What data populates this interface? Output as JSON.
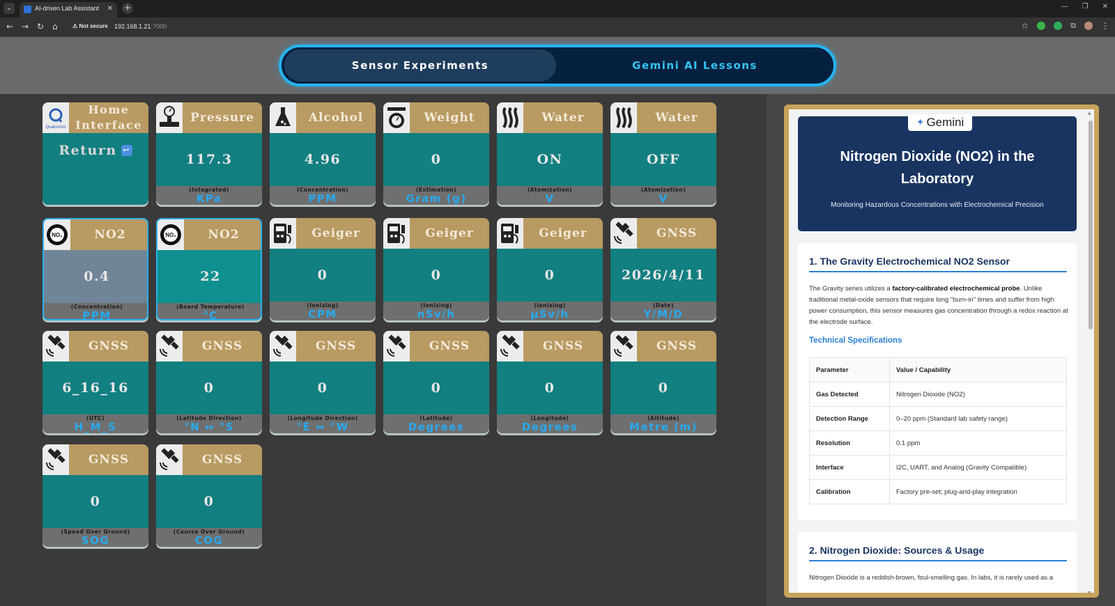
{
  "browser": {
    "tab_title": "AI-driven Lab Assistant",
    "tab_close": "✕",
    "new_tab": "+",
    "security": "Not secure",
    "url_host": "192.168.1.21",
    "url_port": ":7000"
  },
  "switch": {
    "left_label": "Sensor Experiments",
    "right_label": "Gemini AI Lessons"
  },
  "cards": [
    {
      "title": "Home Interface",
      "value": "Return",
      "sub": "",
      "unit": "",
      "icon": "qualcomm-logo-icon"
    },
    {
      "title": "Pressure",
      "value": "117.3",
      "sub": "(Integrated)",
      "unit": "KPa",
      "icon": "pressure-gauge-icon"
    },
    {
      "title": "Alcohol",
      "value": "4.96",
      "sub": "(Concentration)",
      "unit": "PPM",
      "icon": "flask-icon"
    },
    {
      "title": "Weight",
      "value": "0",
      "sub": "(Estimation)",
      "unit": "Gram (g)",
      "icon": "scale-icon"
    },
    {
      "title": "Water",
      "value": "ON",
      "sub": "(Atomization)",
      "unit": "V",
      "icon": "mist-icon"
    },
    {
      "title": "Water",
      "value": "OFF",
      "sub": "(Atomization)",
      "unit": "V",
      "icon": "mist-icon"
    },
    {
      "title": "NO2",
      "value": "0.4",
      "sub": "(Concentration)",
      "unit": "PPM",
      "icon": "no2-gear-icon"
    },
    {
      "title": "NO2",
      "value": "22",
      "sub": "(Board Temperature)",
      "unit": "°C",
      "icon": "no2-gear-icon"
    },
    {
      "title": "Geiger",
      "value": "0",
      "sub": "(Ionizing)",
      "unit": "CPM",
      "icon": "geiger-counter-icon"
    },
    {
      "title": "Geiger",
      "value": "0",
      "sub": "(Ionizing)",
      "unit": "nSv/h",
      "icon": "geiger-counter-icon"
    },
    {
      "title": "Geiger",
      "value": "0",
      "sub": "(Ionizing)",
      "unit": "μSv/h",
      "icon": "geiger-counter-icon"
    },
    {
      "title": "GNSS",
      "value": "2026/4/11",
      "sub": "(Date)",
      "unit": "Y/M/D",
      "icon": "satellite-icon"
    },
    {
      "title": "GNSS",
      "value": "6_16_16",
      "sub": "(UTC)",
      "unit": "H_M_S",
      "icon": "satellite-icon"
    },
    {
      "title": "GNSS",
      "value": "0",
      "sub": "(Latitude Direction)",
      "unit": "°N ↔ °S",
      "icon": "satellite-icon"
    },
    {
      "title": "GNSS",
      "value": "0",
      "sub": "(Longitude Direction)",
      "unit": "°E ↔ °W",
      "icon": "satellite-icon"
    },
    {
      "title": "GNSS",
      "value": "0",
      "sub": "(Latitude)",
      "unit": "Degrees",
      "icon": "satellite-icon"
    },
    {
      "title": "GNSS",
      "value": "0",
      "sub": "(Longitude)",
      "unit": "Degrees",
      "icon": "satellite-icon"
    },
    {
      "title": "GNSS",
      "value": "0",
      "sub": "(Altitude)",
      "unit": "Metre (m)",
      "icon": "satellite-icon"
    },
    {
      "title": "GNSS",
      "value": "0",
      "sub": "(Speed Over Ground)",
      "unit": "SOG",
      "icon": "satellite-icon"
    },
    {
      "title": "GNSS",
      "value": "0",
      "sub": "(Course Over Ground)",
      "unit": "COG",
      "icon": "satellite-icon"
    }
  ],
  "lesson": {
    "logo_text": "Gemini",
    "title": "Nitrogen Dioxide (NO2) in the Laboratory",
    "subtitle": "Monitoring Hazardous Concentrations with Electrochemical Precision",
    "section1_title": "1. The Gravity Electrochemical NO2 Sensor",
    "section1_text_a": "The Gravity series utilizes a ",
    "section1_text_bold": "factory-calibrated electrochemical probe",
    "section1_text_b": ". Unlike traditional metal-oxide sensors that require long \"burn-in\" times and suffer from high power consumption, this sensor measures gas concentration through a redox reaction at the electrode surface.",
    "tech_title": "Technical Specifications",
    "table_headers": [
      "Parameter",
      "Value / Capability"
    ],
    "table_rows": [
      [
        "Gas Detected",
        "Nitrogen Dioxide (NO2)"
      ],
      [
        "Detection Range",
        "0–20 ppm (Standard lab safety range)"
      ],
      [
        "Resolution",
        "0.1 ppm"
      ],
      [
        "Interface",
        "I2C, UART, and Analog (Gravity Compatible)"
      ],
      [
        "Calibration",
        "Factory pre-set; plug-and-play integration"
      ]
    ],
    "section2_title": "2. Nitrogen Dioxide: Sources & Usage",
    "section2_text": "Nitrogen Dioxide is a reddish-brown, foul-smelling gas. In labs, it is rarely used as a"
  }
}
